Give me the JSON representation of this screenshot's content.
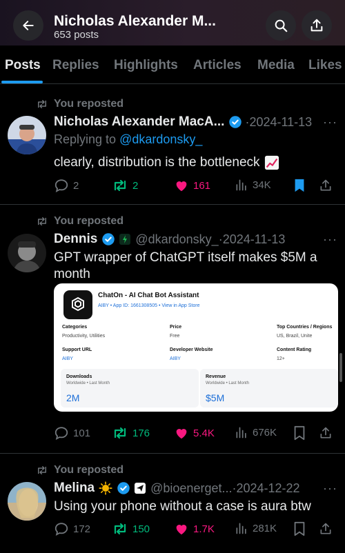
{
  "header": {
    "name": "Nicholas Alexander M...",
    "post_count": "653 posts"
  },
  "tabs": [
    "Posts",
    "Replies",
    "Highlights",
    "Articles",
    "Media",
    "Likes"
  ],
  "posts": [
    {
      "repost_label": "You reposted",
      "author_name": "Nicholas Alexander MacA...",
      "separator": "·",
      "date": "2024-11-13",
      "reply_prefix": "Replying to ",
      "reply_handle": "@dkardonsky_",
      "text": "clearly, distribution is the bottleneck",
      "replies": "2",
      "reposts": "2",
      "likes": "161",
      "views": "34K",
      "bookmarked": true
    },
    {
      "repost_label": "You reposted",
      "author_name": "Dennis",
      "handle": "@dkardonsky_",
      "separator": "·",
      "date": "2024-11-13",
      "text": "GPT wrapper of ChatGPT itself makes $5M a month",
      "replies": "101",
      "reposts": "176",
      "likes": "5.4K",
      "views": "676K",
      "card": {
        "app_title": "ChatOn - AI Chat Bot Assistant",
        "app_sub": "AIBY • App ID: 1661308505 • View in App Store",
        "categories_label": "Categories",
        "categories_value": "Productivity, Utilities",
        "price_label": "Price",
        "price_value": "Free",
        "countries_label": "Top Countries / Regions",
        "countries_value": "US, Brazil, Unite",
        "support_label": "Support URL",
        "support_value": "AIBY",
        "developer_label": "Developer Website",
        "developer_value": "AIBY",
        "rating_label": "Content Rating",
        "rating_value": "12+",
        "downloads_label": "Downloads",
        "downloads_sub": "Worldwide • Last Month",
        "downloads_value": "2M",
        "revenue_label": "Revenue",
        "revenue_sub": "Worldwide • Last Month",
        "revenue_value": "$5M"
      }
    },
    {
      "repost_label": "You reposted",
      "author_name": "Melina",
      "handle": "@bioenerget...",
      "separator": "·",
      "date": "2024-12-22",
      "text": "Using your phone without a case is aura btw",
      "replies": "172",
      "reposts": "150",
      "likes": "1.7K",
      "views": "281K"
    }
  ],
  "colors": {
    "accent": "#1d9bf0",
    "repost_green": "#00ba7c",
    "like_pink": "#f91880",
    "muted": "#71767b"
  }
}
